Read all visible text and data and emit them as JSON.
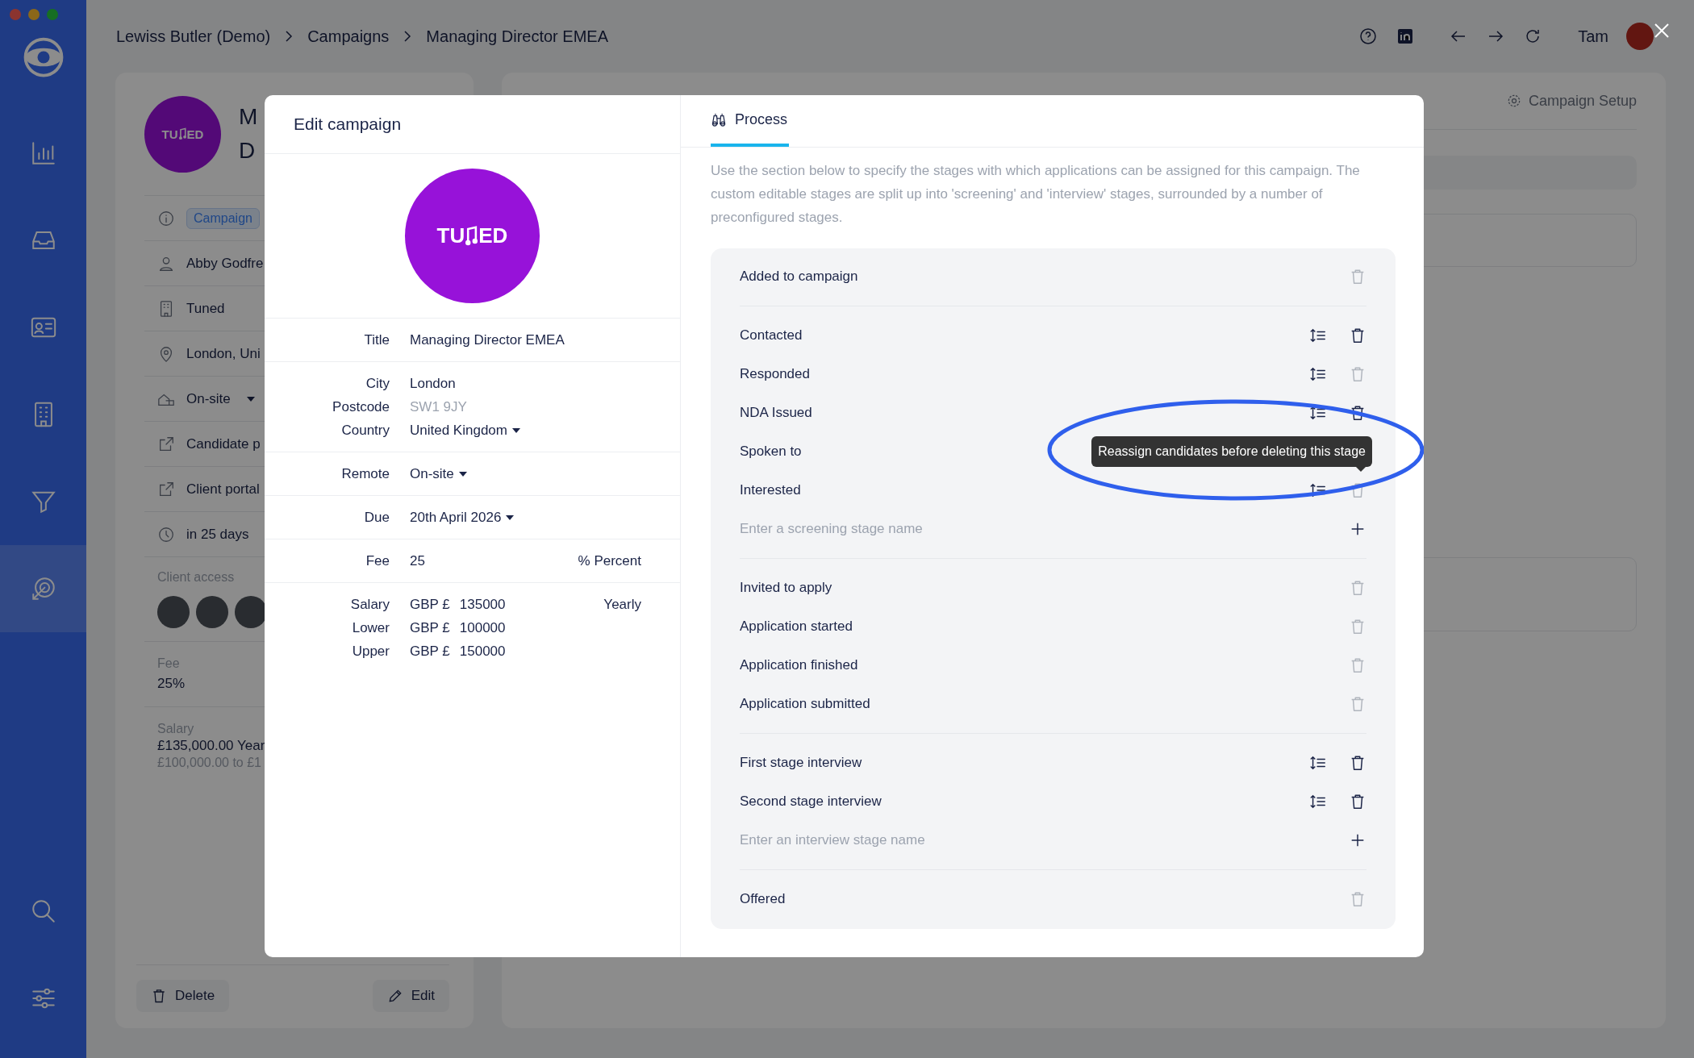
{
  "breadcrumb": [
    "Lewiss Butler (Demo)",
    "Campaigns",
    "Managing Director EMEA"
  ],
  "user": {
    "name": "Tam"
  },
  "sidebar": {
    "items": [
      {
        "kind": "chart",
        "selected": false
      },
      {
        "kind": "inbox",
        "selected": false
      },
      {
        "kind": "contact",
        "selected": false
      },
      {
        "kind": "building",
        "selected": false
      },
      {
        "kind": "funnel",
        "selected": false
      },
      {
        "kind": "target",
        "selected": true
      }
    ],
    "bottom_items": [
      {
        "kind": "search",
        "selected": false
      },
      {
        "kind": "sliders",
        "selected": false
      }
    ]
  },
  "campaign_card": {
    "logo_text": [
      "TU",
      "ED"
    ],
    "title_fragments": [
      "M",
      "D"
    ],
    "badge": "Campaign",
    "details": [
      {
        "kind": "person",
        "text": "Abby Godfre",
        "dropdown": false
      },
      {
        "kind": "building",
        "text": "Tuned",
        "dropdown": false
      },
      {
        "kind": "pin",
        "text": "London, Uni",
        "dropdown": false
      },
      {
        "kind": "remote",
        "text": "On-site",
        "dropdown": true
      },
      {
        "kind": "link",
        "text": "Candidate p",
        "dropdown": false
      },
      {
        "kind": "link",
        "text": "Client portal",
        "dropdown": false
      },
      {
        "kind": "clock",
        "text": "in 25 days",
        "dropdown": false
      }
    ],
    "client_access": {
      "label": "Client access",
      "avatars": [
        {
          "kind": "photo"
        },
        {
          "kind": "photo"
        },
        {
          "kind": "photo"
        }
      ]
    },
    "fee": {
      "label": "Fee",
      "value": "25%"
    },
    "salary": {
      "label": "Salary",
      "lines": [
        "£135,000.00 Year",
        "£100,000.00 to £1"
      ]
    },
    "buttons": [
      {
        "kind": "delete",
        "label": "Delete"
      },
      {
        "kind": "edit",
        "label": "Edit"
      }
    ]
  },
  "main_panel": {
    "setup_button": "Campaign Setup"
  },
  "modal": {
    "title": "Edit campaign",
    "logo_text": [
      "TU",
      "ED"
    ],
    "field_groups": [
      [
        {
          "label": "Title",
          "kind": "text",
          "value": "Managing Director EMEA"
        }
      ],
      [
        {
          "label": "City",
          "kind": "text",
          "value": "London"
        },
        {
          "label": "Postcode",
          "kind": "input",
          "placeholder": "SW1 9JY"
        },
        {
          "label": "Country",
          "kind": "dropdown",
          "value": "United Kingdom"
        }
      ],
      [
        {
          "label": "Remote",
          "kind": "dropdown",
          "value": "On-site"
        }
      ],
      [
        {
          "label": "Due",
          "kind": "dropdown",
          "value": "20th April 2026"
        }
      ],
      [
        {
          "label": "Fee",
          "kind": "text",
          "value": "25",
          "suffix": "% Percent"
        }
      ],
      [
        {
          "label": "Salary",
          "kind": "money",
          "currency": "GBP £",
          "value": "135000",
          "suffix": "Yearly"
        },
        {
          "label": "Lower",
          "kind": "money",
          "currency": "GBP £",
          "value": "100000"
        },
        {
          "label": "Upper",
          "kind": "money",
          "currency": "GBP £",
          "value": "150000"
        }
      ]
    ],
    "tabs": [
      {
        "label": "Process",
        "selected": true
      }
    ],
    "description": "Use the section below to specify the stages with which applications can be assigned for this campaign. The custom editable stages are split up into 'screening' and 'interview' stages, surrounded by a number of preconfigured stages.",
    "stage_groups": [
      [
        {
          "kind": "stage",
          "name": "Added to campaign",
          "reorderable": false,
          "deletable": false
        }
      ],
      [
        {
          "kind": "stage",
          "name": "Contacted",
          "reorderable": true,
          "deletable": true
        },
        {
          "kind": "stage",
          "name": "Responded",
          "reorderable": true,
          "deletable": false
        },
        {
          "kind": "stage",
          "name": "NDA Issued",
          "reorderable": true,
          "deletable": true
        },
        {
          "kind": "stage",
          "name": "Spoken to"
        },
        {
          "kind": "stage",
          "name": "Interested",
          "reorderable": true,
          "deletable": false,
          "tooltip": "Reassign candidates before deleting this stage",
          "circled": true
        },
        {
          "kind": "input",
          "placeholder": "Enter a screening stage name"
        }
      ],
      [
        {
          "kind": "stage",
          "name": "Invited to apply",
          "reorderable": false,
          "deletable": false
        },
        {
          "kind": "stage",
          "name": "Application started",
          "reorderable": false,
          "deletable": false
        },
        {
          "kind": "stage",
          "name": "Application finished",
          "reorderable": false,
          "deletable": false
        },
        {
          "kind": "stage",
          "name": "Application submitted",
          "reorderable": false,
          "deletable": false
        }
      ],
      [
        {
          "kind": "stage",
          "name": "First stage interview",
          "reorderable": true,
          "deletable": true
        },
        {
          "kind": "stage",
          "name": "Second stage interview",
          "reorderable": true,
          "deletable": true
        },
        {
          "kind": "input",
          "placeholder": "Enter an interview stage name"
        }
      ],
      [
        {
          "kind": "stage",
          "name": "Offered",
          "reorderable": false,
          "deletable": false
        }
      ]
    ]
  }
}
